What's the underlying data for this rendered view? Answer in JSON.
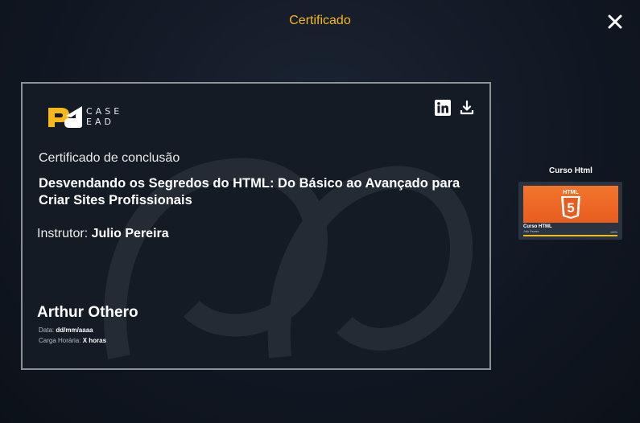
{
  "modal": {
    "title": "Certificado",
    "close_icon": "close-icon"
  },
  "certificate": {
    "logo_text_top": "CASE",
    "logo_text_bottom": "EAD",
    "label": "Certificado de conclusão",
    "course_name": "Desvendando os Segredos do HTML: Do Básico ao Avançado para Criar Sites Profissionais",
    "instructor_label": "Instrutor:",
    "instructor_name": "Julio Pereira",
    "student_name": "Arthur Othero",
    "date_label": "Data:",
    "date_value": "dd/mm/aaaa",
    "hours_label": "Carga Horária:",
    "hours_value": "X horas",
    "actions": [
      {
        "icon": "linkedin-icon"
      },
      {
        "icon": "download-icon"
      }
    ]
  },
  "sidebar": {
    "title": "Curso Html",
    "thumbnail": {
      "badge_text": "HTML",
      "badge_number": "5",
      "caption": "Curso HTML",
      "subcaption": "Julio Pereira",
      "progress_label": "100%",
      "progress": 1.0
    }
  },
  "colors": {
    "accent": "#f6b71a",
    "background": "#111722",
    "html_orange": "#e85d1f"
  }
}
